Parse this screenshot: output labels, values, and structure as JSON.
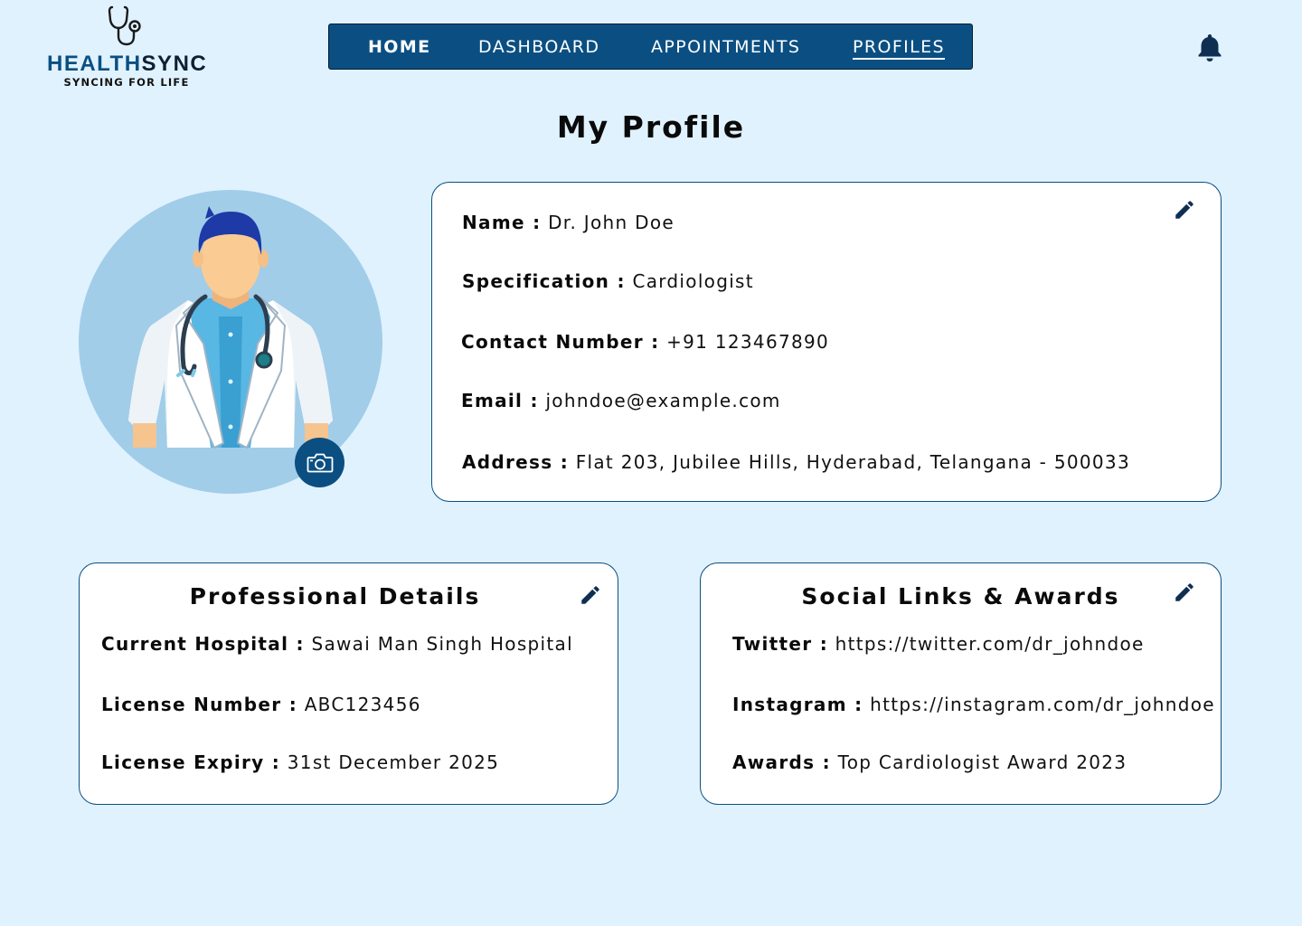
{
  "brand": {
    "name_part1": "HEALTH",
    "name_part2": "SYNC",
    "tagline": "SYNCING FOR LIFE",
    "colors": {
      "primary": "#0b4f82",
      "dark": "#0f1f33"
    }
  },
  "nav": {
    "items": [
      {
        "label": "HOME"
      },
      {
        "label": "DASHBOARD"
      },
      {
        "label": "APPOINTMENTS"
      },
      {
        "label": "PROFILES",
        "active": true
      }
    ],
    "notification_icon": "bell-icon"
  },
  "page": {
    "title": "My Profile"
  },
  "avatar": {
    "icon": "doctor-avatar",
    "upload_icon": "camera-icon"
  },
  "personal": {
    "name_label": "Name :",
    "name": "Dr. John Doe",
    "spec_label": "Specification :",
    "spec": "Cardiologist",
    "contact_label": "Contact Number :",
    "contact": "+91 123467890",
    "email_label": "Email :",
    "email": "johndoe@example.com",
    "address_label": "Address :",
    "address": "Flat 203, Jubilee Hills, Hyderabad, Telangana - 500033",
    "edit_icon": "pencil-icon"
  },
  "professional": {
    "title": "Professional Details",
    "hospital_label": "Current Hospital :",
    "hospital": "Sawai Man Singh Hospital",
    "license_label": "License Number :",
    "license": "ABC123456",
    "expiry_label": "License Expiry :",
    "expiry": "31st December 2025",
    "edit_icon": "pencil-icon"
  },
  "social": {
    "title": "Social Links & Awards",
    "twitter_label": "Twitter :",
    "twitter": "https://twitter.com/dr_johndoe",
    "instagram_label": "Instagram :",
    "instagram": "https://instagram.com/dr_johndoe",
    "awards_label": "Awards :",
    "awards": "Top Cardiologist Award 2023",
    "edit_icon": "pencil-icon"
  }
}
